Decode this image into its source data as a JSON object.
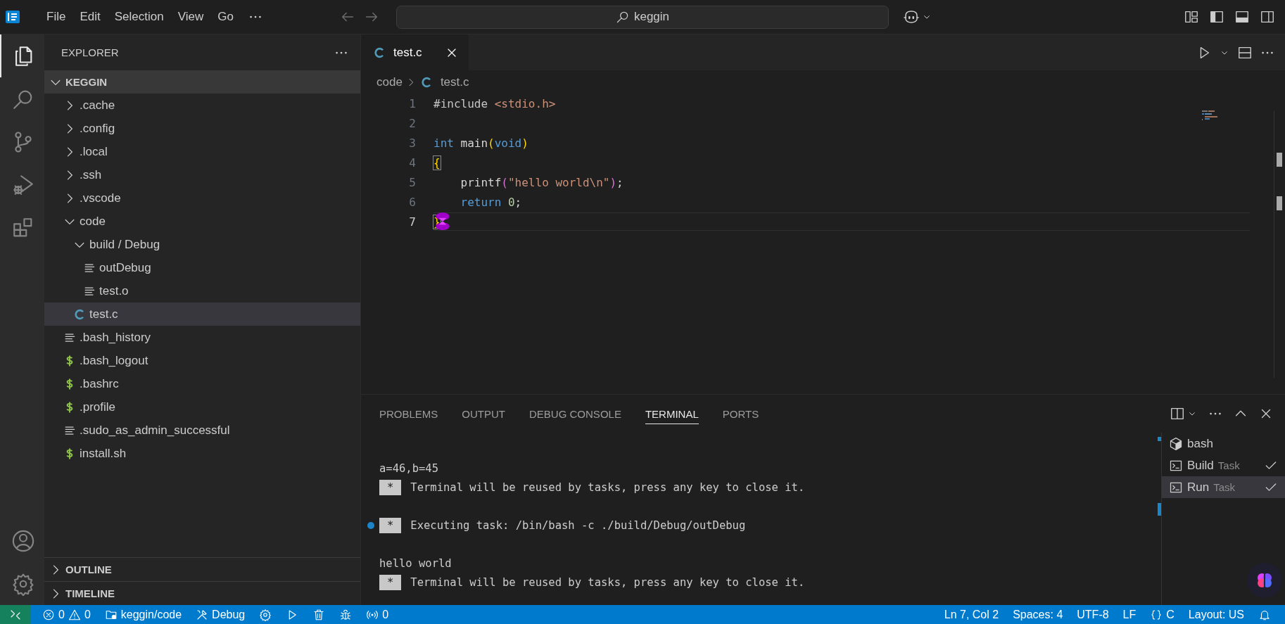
{
  "title_bar": {
    "menu": [
      "File",
      "Edit",
      "Selection",
      "View",
      "Go"
    ],
    "search": "keggin"
  },
  "activity_bar": {
    "top": [
      {
        "kind": "files",
        "selected": true
      },
      {
        "kind": "search",
        "selected": false
      },
      {
        "kind": "source-control",
        "selected": false
      },
      {
        "kind": "run-debug",
        "selected": false
      },
      {
        "kind": "extensions",
        "selected": false
      }
    ],
    "bottom": [
      {
        "kind": "account"
      },
      {
        "kind": "manage"
      }
    ]
  },
  "sidebar": {
    "title": "EXPLORER",
    "root": {
      "label": "KEGGIN",
      "expanded": true
    },
    "tree": [
      {
        "label": ".cache",
        "kind": "folder",
        "expanded": false,
        "selected": false
      },
      {
        "label": ".config",
        "kind": "folder",
        "expanded": false,
        "selected": false
      },
      {
        "label": ".local",
        "kind": "folder",
        "expanded": false,
        "selected": false
      },
      {
        "label": ".ssh",
        "kind": "folder",
        "expanded": false,
        "selected": false
      },
      {
        "label": ".vscode",
        "kind": "folder",
        "expanded": false,
        "selected": false
      },
      {
        "label": "code",
        "kind": "folder",
        "expanded": true,
        "selected": false,
        "children": [
          {
            "label": "build / Debug",
            "kind": "folder",
            "expanded": true,
            "selected": false,
            "children": [
              {
                "label": "outDebug",
                "kind": "text",
                "selected": false
              },
              {
                "label": "test.o",
                "kind": "text",
                "selected": false
              }
            ]
          },
          {
            "label": "test.c",
            "kind": "c",
            "selected": true
          }
        ]
      },
      {
        "label": ".bash_history",
        "kind": "text",
        "selected": false
      },
      {
        "label": ".bash_logout",
        "kind": "shell",
        "selected": false
      },
      {
        "label": ".bashrc",
        "kind": "shell",
        "selected": false
      },
      {
        "label": ".profile",
        "kind": "shell",
        "selected": false
      },
      {
        "label": ".sudo_as_admin_successful",
        "kind": "text",
        "selected": false
      },
      {
        "label": "install.sh",
        "kind": "shell",
        "selected": false
      }
    ],
    "sections": [
      {
        "label": "OUTLINE",
        "expanded": false
      },
      {
        "label": "TIMELINE",
        "expanded": false
      }
    ]
  },
  "editor": {
    "tabs": [
      {
        "label": "test.c",
        "kind": "c",
        "selected": true
      }
    ],
    "breadcrumb": [
      {
        "label": "code",
        "kind": "folder"
      },
      {
        "label": "test.c",
        "kind": "c"
      }
    ],
    "lines": [
      {
        "number": "1",
        "current": false,
        "tokens": [
          {
            "text": "#include ",
            "kind": "directive"
          },
          {
            "text": "<stdio.h>",
            "kind": "string"
          }
        ]
      },
      {
        "number": "2",
        "current": false
      },
      {
        "number": "3",
        "current": false,
        "tokens": [
          {
            "text": "int",
            "kind": "keyword"
          },
          {
            "text": " main",
            "kind": "plain"
          },
          {
            "text": "(",
            "kind": "bracket1"
          },
          {
            "text": "void",
            "kind": "keyword"
          },
          {
            "text": ")",
            "kind": "bracket1"
          }
        ]
      },
      {
        "number": "4",
        "current": false,
        "tokens": [
          {
            "text": "{",
            "kind": "bracket1",
            "matched": true
          }
        ]
      },
      {
        "number": "5",
        "current": false,
        "tokens": [
          {
            "text": "    printf",
            "kind": "plain"
          },
          {
            "text": "(",
            "kind": "bracket2"
          },
          {
            "text": "\"hello world\\n\"",
            "kind": "string"
          },
          {
            "text": ")",
            "kind": "bracket2"
          },
          {
            "text": ";",
            "kind": "plain"
          }
        ]
      },
      {
        "number": "6",
        "current": false,
        "tokens": [
          {
            "text": "    return ",
            "kind": "keyword"
          },
          {
            "text": "0",
            "kind": "number"
          },
          {
            "text": ";",
            "kind": "plain"
          }
        ]
      },
      {
        "number": "7",
        "current": true,
        "tokens": [
          {
            "text": "}",
            "kind": "bracket1",
            "matched": true
          }
        ]
      }
    ]
  },
  "panel": {
    "tabs": [
      {
        "label": "PROBLEMS",
        "selected": false
      },
      {
        "label": "OUTPUT",
        "selected": false
      },
      {
        "label": "DEBUG CONSOLE",
        "selected": false
      },
      {
        "label": "TERMINAL",
        "selected": true
      },
      {
        "label": "PORTS",
        "selected": false
      }
    ],
    "terminal": [
      {
        "kind": "blank"
      },
      {
        "kind": "text",
        "text": "a=46,b=45"
      },
      {
        "kind": "task",
        "badge": "*",
        "text": "Terminal will be reused by tasks, press any key to close it.",
        "marker": false
      },
      {
        "kind": "blank"
      },
      {
        "kind": "task",
        "badge": "*",
        "text": "Executing task: /bin/bash -c ./build/Debug/outDebug",
        "marker": true
      },
      {
        "kind": "blank"
      },
      {
        "kind": "text",
        "text": "hello world"
      },
      {
        "kind": "task",
        "badge": "*",
        "text": "Terminal will be reused by tasks, press any key to close it.",
        "marker": false
      }
    ],
    "terminals": [
      {
        "kind": "shell",
        "name": "bash",
        "done": false,
        "selected": false
      },
      {
        "kind": "task",
        "name": "Build",
        "detail": "Task",
        "done": true,
        "selected": false
      },
      {
        "kind": "task",
        "name": "Run",
        "detail": "Task",
        "done": true,
        "selected": true
      }
    ]
  },
  "status_bar": {
    "left": [
      {
        "kind": "remote"
      },
      {
        "kind": "problems",
        "errors": "0",
        "warnings": "0"
      },
      {
        "kind": "folder",
        "text": "keggin/code"
      },
      {
        "kind": "debug",
        "text": "Debug"
      },
      {
        "kind": "settings"
      },
      {
        "kind": "run"
      },
      {
        "kind": "delete"
      },
      {
        "kind": "bug"
      },
      {
        "kind": "ports",
        "text": "0"
      }
    ],
    "right": [
      {
        "kind": "text",
        "text": "Ln 7, Col 2"
      },
      {
        "kind": "text",
        "text": "Spaces: 4"
      },
      {
        "kind": "text",
        "text": "UTF-8"
      },
      {
        "kind": "text",
        "text": "LF"
      },
      {
        "kind": "language",
        "text": "C"
      },
      {
        "kind": "text",
        "text": "Layout: US"
      },
      {
        "kind": "bell"
      }
    ]
  }
}
